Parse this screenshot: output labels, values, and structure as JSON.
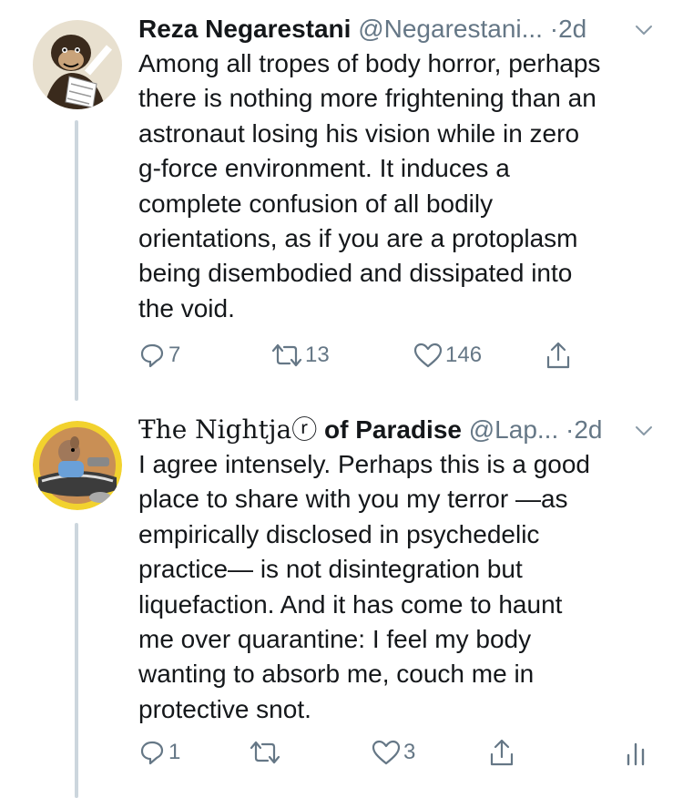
{
  "tweets": [
    {
      "display_name": "Reza Negarestani",
      "handle": "@Negarestani...",
      "dot": "·",
      "time": "2d",
      "avatar_icon": "monkey-avatar-icon",
      "text_lines": [
        "Among all tropes of body horror, perhaps",
        "there is nothing more frightening than an",
        "astronaut losing his vision while in zero",
        "g-force environment. It induces a",
        "complete confusion of all bodily",
        "orientations, as if you are a protoplasm",
        "being disembodied and dissipated into",
        "the void."
      ],
      "replies": "7",
      "retweets": "13",
      "likes": "146"
    },
    {
      "display_name_fancy": "Ŧhe Nightjaⓡ",
      "display_name_rest": " of Paradise",
      "handle": "@Lap...",
      "dot": "·",
      "time": "2d",
      "avatar_icon": "cartoon-pilot-avatar-icon",
      "text_lines": [
        "I agree intensely. Perhaps this is a good",
        "place to share with you my terror —as",
        "empirically disclosed in psychedelic",
        "practice— is not disintegration but",
        "liquefaction. And it has come to haunt",
        "me over quarantine: I feel my body",
        "wanting to absorb me, couch me in",
        "protective snot."
      ],
      "replies": "1",
      "retweets": "",
      "likes": "3"
    }
  ],
  "colors": {
    "text": "#14171a",
    "secondary": "#657786",
    "thread_line": "#ccd6dd"
  }
}
